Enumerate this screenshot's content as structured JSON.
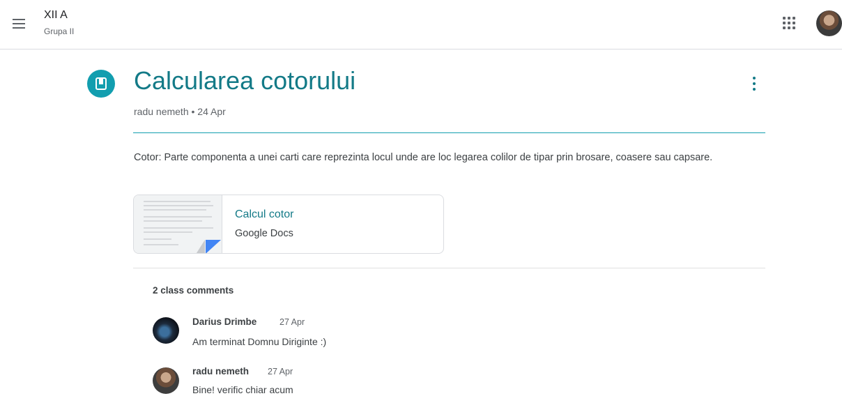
{
  "header": {
    "class_name": "XII A",
    "class_section": "Grupa II",
    "menu_icon": "hamburger-menu-icon",
    "apps_icon": "google-apps-grid-icon"
  },
  "post": {
    "title": "Calcularea cotorului",
    "meta": "radu nemeth • 24 Apr",
    "body": "Cotor: Parte componenta a unei carti care reprezinta locul unde are loc legarea colilor de tipar prin brosare, coasere sau capsare.",
    "type_icon": "material-book-icon",
    "more_icon": "more-vertical-icon",
    "accent_color": "#129eaf",
    "title_color": "#137a87"
  },
  "attachment": {
    "title": "Calcul cotor",
    "source": "Google Docs"
  },
  "comments": {
    "heading": "2 class comments",
    "items": [
      {
        "author": "Darius Drimbe",
        "date": "27 Apr",
        "text": "Am terminat Domnu Diriginte :)"
      },
      {
        "author": "radu nemeth",
        "date": "27 Apr",
        "text": "Bine! verific chiar acum"
      }
    ]
  }
}
